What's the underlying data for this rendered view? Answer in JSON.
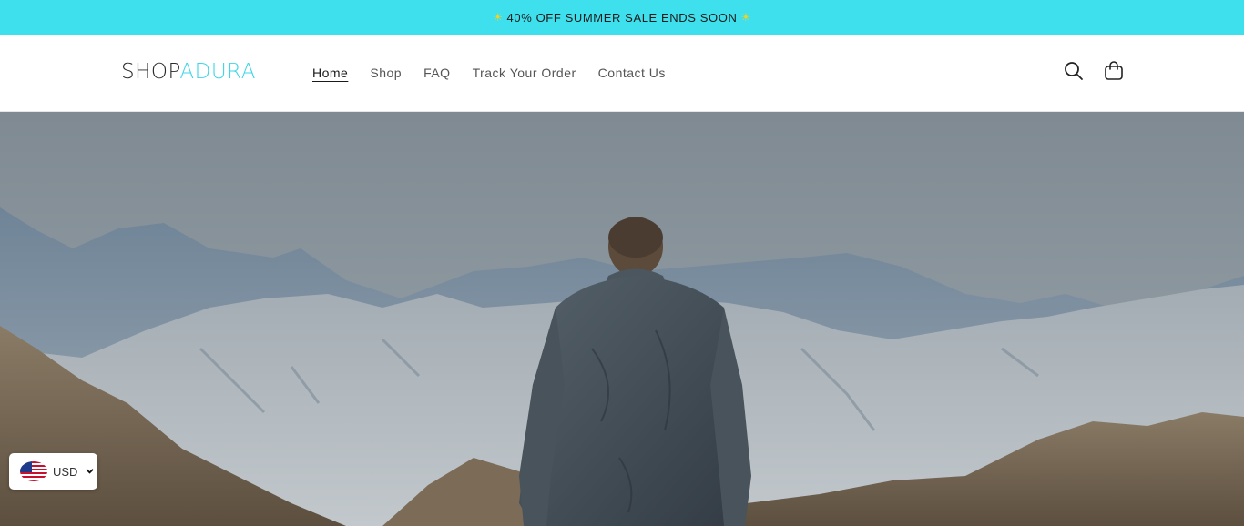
{
  "announcement": {
    "text": "40% OFF SUMMER SALE ENDS SOON",
    "star": "☀"
  },
  "logo": {
    "part1": "SHOP",
    "part2": "ADURA"
  },
  "nav": {
    "items": [
      {
        "label": "Home",
        "active": true
      },
      {
        "label": "Shop"
      },
      {
        "label": "FAQ"
      },
      {
        "label": "Track Your Order"
      },
      {
        "label": "Contact Us"
      }
    ]
  },
  "icons": {
    "search": "search-icon",
    "cart": "cart-icon"
  },
  "hero": {
    "description": "Hiker in grey jacket facing mountain range"
  },
  "currency": {
    "code": "USD",
    "flag": "us-flag-icon"
  },
  "colors": {
    "announce_bg": "#3fe0ee",
    "logo_accent": "#3fd6e8"
  }
}
